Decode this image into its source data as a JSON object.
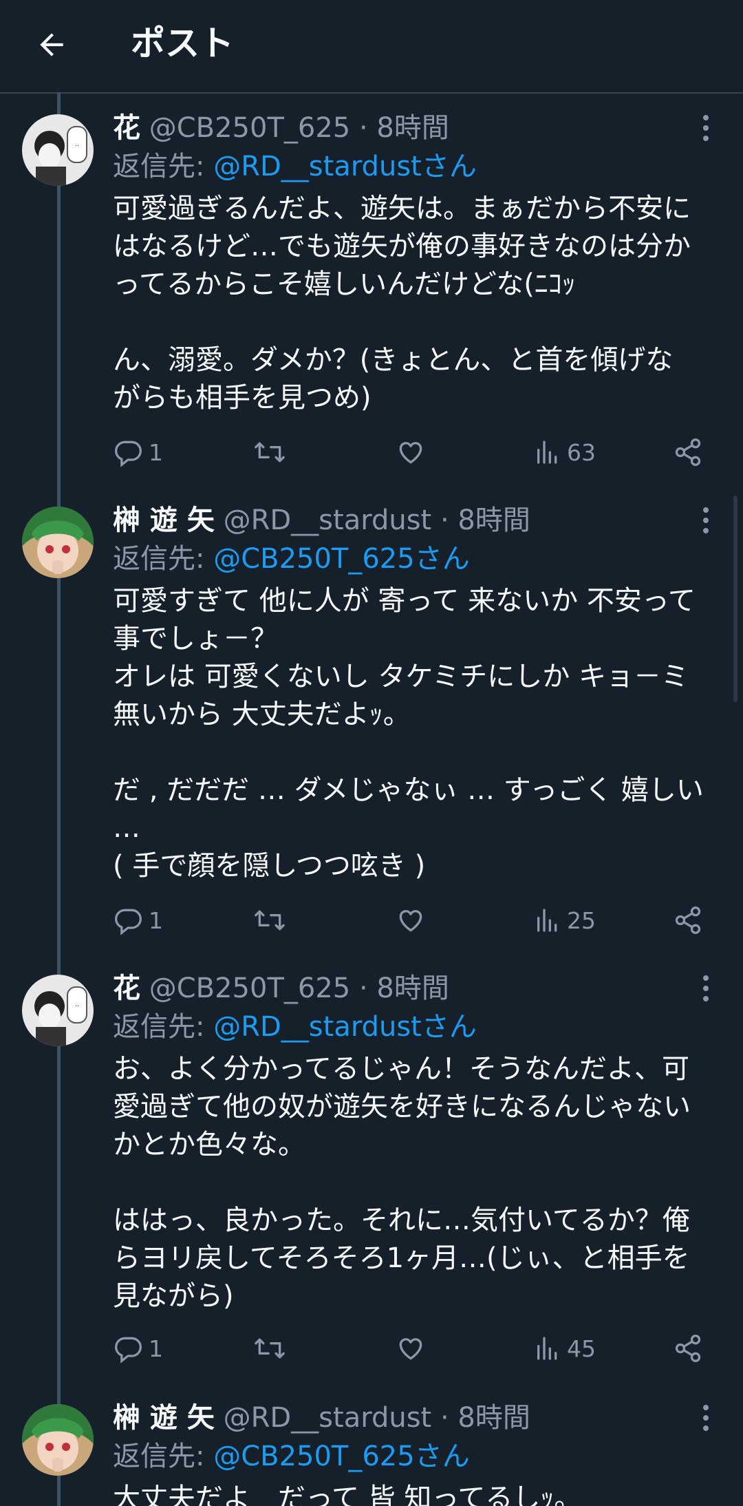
{
  "header": {
    "title": "ポスト"
  },
  "tweets": [
    {
      "name": "花",
      "handle": "@CB250T_625",
      "dot": "·",
      "time": "8時間",
      "reply_label": "返信先: ",
      "reply_to": "@RD__stardustさん",
      "body": "可愛過ぎるんだよ、遊矢は。まぁだから不安に\nはなるけど…でも遊矢が俺の事好きなのは分か\nってるからこそ嬉しいんだけどな(ﾆｺｯ\n\nん、溺愛。ダメか？(きょとん、と首を傾げな\nがらも相手を見つめ)",
      "replies": "1",
      "retweets": "",
      "likes": "",
      "views": "63"
    },
    {
      "name": "榊 遊 矢",
      "handle": "@RD__stardust",
      "dot": "·",
      "time": "8時間",
      "reply_label": "返信先: ",
      "reply_to": "@CB250T_625さん",
      "body": "可愛すぎて 他に人が 寄って 来ないか 不安って\n事でしょ－？\nオレは 可愛くないし タケミチにしか キョ－ミ\n無いから 大丈夫だよｯ。\n\nだ , だだだ … ダメじゃなぃ … すっごく 嬉しい\n…\n( 手で顔を隠しつつ呟き )",
      "replies": "1",
      "retweets": "",
      "likes": "",
      "views": "25"
    },
    {
      "name": "花",
      "handle": "@CB250T_625",
      "dot": "·",
      "time": "8時間",
      "reply_label": "返信先: ",
      "reply_to": "@RD__stardustさん",
      "body": "お、よく分かってるじゃん！そうなんだよ、可\n愛過ぎて他の奴が遊矢を好きになるんじゃない\nかとか色々な。\n\nははっ、良かった。それに…気付いてるか？俺\nらヨリ戻してそろそろ1ヶ月…(じぃ、と相手を\n見ながら)",
      "replies": "1",
      "retweets": "",
      "likes": "",
      "views": "45"
    },
    {
      "name": "榊 遊 矢",
      "handle": "@RD__stardust",
      "dot": "·",
      "time": "8時間",
      "reply_label": "返信先: ",
      "reply_to": "@CB250T_625さん",
      "body": "大丈夫だよ　だって 皆 知ってるしｯ。"
    }
  ],
  "colors": {
    "background": "#15202b",
    "text": "#f7f9f9",
    "secondary": "#8b98a5",
    "link": "#1d9bf0",
    "thread_line": "#3d5466"
  },
  "icons": [
    "back-arrow-icon",
    "reply-icon",
    "retweet-icon",
    "like-icon",
    "views-icon",
    "share-icon",
    "more-icon"
  ]
}
